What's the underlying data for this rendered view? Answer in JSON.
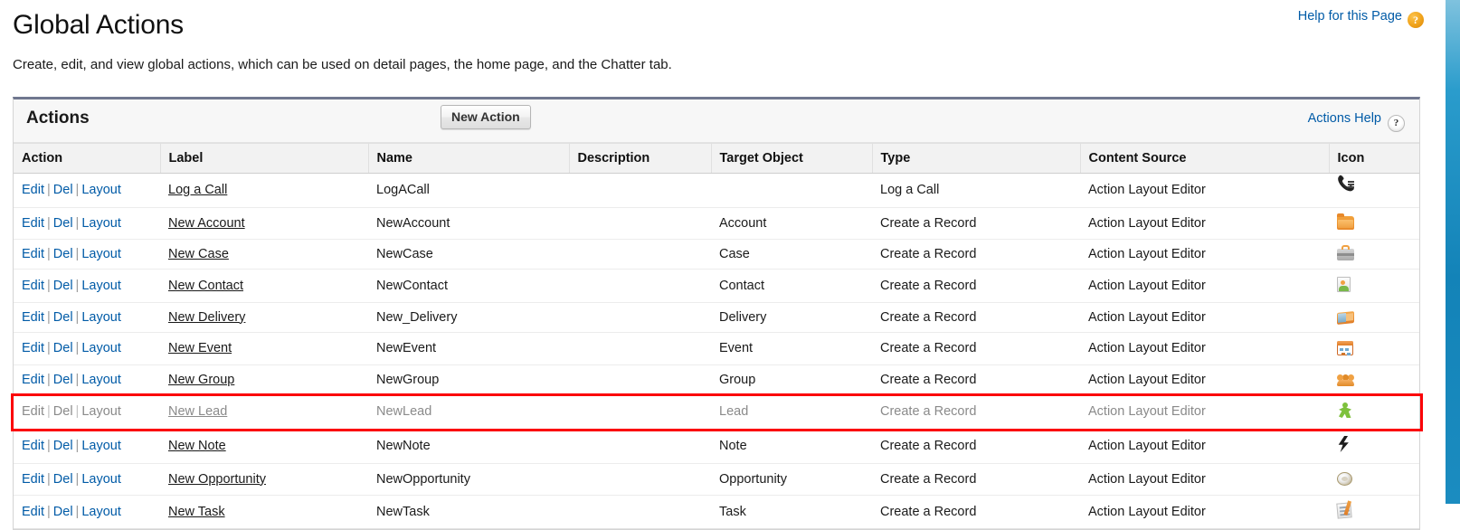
{
  "header": {
    "title": "Global Actions",
    "description": "Create, edit, and view global actions, which can be used on detail pages, the home page, and the Chatter tab.",
    "help_link": "Help for this Page",
    "help_icon": "question-mark-orange-icon"
  },
  "panel": {
    "title": "Actions",
    "new_action_label": "New Action",
    "actions_help_link": "Actions Help",
    "actions_help_icon": "question-mark-grey-icon"
  },
  "table": {
    "columns": [
      "Action",
      "Label",
      "Name",
      "Description",
      "Target Object",
      "Type",
      "Content Source",
      "Icon"
    ],
    "row_links": {
      "edit": "Edit",
      "del": "Del",
      "layout": "Layout",
      "separator": "|"
    },
    "rows": [
      {
        "label": "Log a Call",
        "name": "LogACall",
        "description": "",
        "target_object": "",
        "type": "Log a Call",
        "content_source": "Action Layout Editor",
        "icon": "phone-log-icon",
        "highlighted": false
      },
      {
        "label": "New Account",
        "name": "NewAccount",
        "description": "",
        "target_object": "Account",
        "type": "Create a Record",
        "content_source": "Action Layout Editor",
        "icon": "orange-folder-icon",
        "highlighted": false
      },
      {
        "label": "New Case",
        "name": "NewCase",
        "description": "",
        "target_object": "Case",
        "type": "Create a Record",
        "content_source": "Action Layout Editor",
        "icon": "briefcase-case-icon",
        "highlighted": false
      },
      {
        "label": "New Contact",
        "name": "NewContact",
        "description": "",
        "target_object": "Contact",
        "type": "Create a Record",
        "content_source": "Action Layout Editor",
        "icon": "contact-card-icon",
        "highlighted": false
      },
      {
        "label": "New Delivery",
        "name": "New_Delivery",
        "description": "",
        "target_object": "Delivery",
        "type": "Create a Record",
        "content_source": "Action Layout Editor",
        "icon": "delivery-box-icon",
        "highlighted": false
      },
      {
        "label": "New Event",
        "name": "NewEvent",
        "description": "",
        "target_object": "Event",
        "type": "Create a Record",
        "content_source": "Action Layout Editor",
        "icon": "calendar-event-icon",
        "highlighted": false
      },
      {
        "label": "New Group",
        "name": "NewGroup",
        "description": "",
        "target_object": "Group",
        "type": "Create a Record",
        "content_source": "Action Layout Editor",
        "icon": "people-group-icon",
        "highlighted": false
      },
      {
        "label": "New Lead",
        "name": "NewLead",
        "description": "",
        "target_object": "Lead",
        "type": "Create a Record",
        "content_source": "Action Layout Editor",
        "icon": "green-person-lead-icon",
        "highlighted": true
      },
      {
        "label": "New Note",
        "name": "NewNote",
        "description": "",
        "target_object": "Note",
        "type": "Create a Record",
        "content_source": "Action Layout Editor",
        "icon": "lightning-bolt-note-icon",
        "highlighted": false
      },
      {
        "label": "New Opportunity",
        "name": "NewOpportunity",
        "description": "",
        "target_object": "Opportunity",
        "type": "Create a Record",
        "content_source": "Action Layout Editor",
        "icon": "coin-opportunity-icon",
        "highlighted": false
      },
      {
        "label": "New Task",
        "name": "NewTask",
        "description": "",
        "target_object": "Task",
        "type": "Create a Record",
        "content_source": "Action Layout Editor",
        "icon": "task-checklist-icon",
        "highlighted": false
      }
    ]
  },
  "annotation": {
    "highlight_color": "#fb0007",
    "highlight_row_label": "New Lead"
  }
}
